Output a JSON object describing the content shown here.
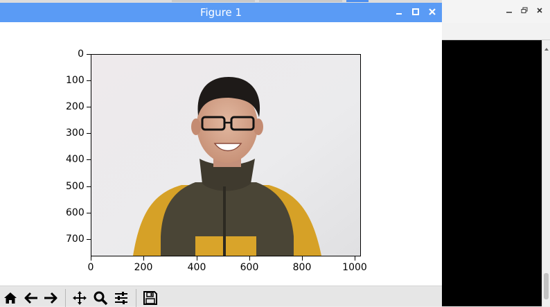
{
  "figure_window": {
    "title": "Figure 1",
    "controls": [
      "minimize",
      "maximize",
      "close"
    ]
  },
  "axes": {
    "y_ticks": [
      "0",
      "100",
      "200",
      "300",
      "400",
      "500",
      "600",
      "700"
    ],
    "x_ticks": [
      "0",
      "200",
      "400",
      "600",
      "800",
      "1000"
    ]
  },
  "toolbar": {
    "buttons": [
      {
        "name": "home",
        "icon": "home-icon"
      },
      {
        "name": "back",
        "icon": "arrow-left-icon"
      },
      {
        "name": "forward",
        "icon": "arrow-right-icon"
      },
      {
        "name": "pan",
        "icon": "move-icon"
      },
      {
        "name": "zoom",
        "icon": "magnifier-icon"
      },
      {
        "name": "configure-subplots",
        "icon": "sliders-icon"
      },
      {
        "name": "save",
        "icon": "floppy-disk-icon"
      }
    ]
  },
  "background_window": {
    "controls": [
      "minimize",
      "restore",
      "close"
    ]
  },
  "colors": {
    "titlebar": "#5a9bf5",
    "shirt_yellow": "#d9a42a",
    "vest_dark": "#4a4536"
  }
}
